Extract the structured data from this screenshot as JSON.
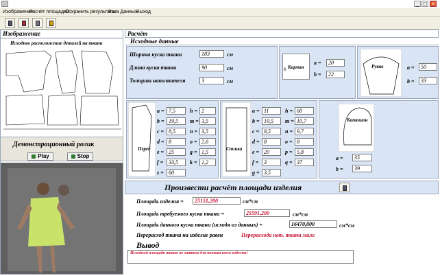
{
  "menu": [
    "Изображение",
    "Расчёт площадей",
    "Сохранить результаты",
    "База Данных",
    "Выход"
  ],
  "toolbar_icons": [
    "calculator-icon",
    "copy-icon",
    "print-icon",
    "exit-door-icon"
  ],
  "window_buttons": [
    "_",
    "□",
    "×"
  ],
  "left": {
    "header": "Изображение",
    "layout_title": "Исходное расположение деталей на ткани",
    "demo_title": "Демонстрационный ролик",
    "play": "Play",
    "stop": "Stop"
  },
  "right": {
    "header": "Расчёт",
    "source_header": "Исходные данные",
    "width_label": "Ширина куска ткани",
    "width_value": "183",
    "length_label": "Длина куска ткани",
    "length_value": "90",
    "filler_label": "Толщина наполнителя",
    "filler_value": "3",
    "unit": "см",
    "pocket": {
      "label": "Карман",
      "a": "20",
      "b": "22"
    },
    "sleeve": {
      "label": "Рукав",
      "a": "50",
      "b": "33"
    },
    "front": {
      "label": "Перед",
      "left": [
        {
          "k": "a",
          "v": "7,5"
        },
        {
          "k": "b",
          "v": "19,5"
        },
        {
          "k": "c",
          "v": "8,5"
        },
        {
          "k": "d",
          "v": "8"
        },
        {
          "k": "e",
          "v": "25"
        },
        {
          "k": "f",
          "v": "33,5"
        },
        {
          "k": "s",
          "v": "60"
        }
      ],
      "right": [
        {
          "k": "h",
          "v": "2"
        },
        {
          "k": "m",
          "v": "3,5"
        },
        {
          "k": "n",
          "v": "3,5"
        },
        {
          "k": "o",
          "v": "2,6"
        },
        {
          "k": "g",
          "v": "1,5"
        },
        {
          "k": "k",
          "v": "1,2"
        }
      ]
    },
    "back": {
      "label": "Спинка",
      "left": [
        {
          "k": "a",
          "v": "11"
        },
        {
          "k": "b",
          "v": "19,5"
        },
        {
          "k": "c",
          "v": "8,5"
        },
        {
          "k": "d",
          "v": "8"
        },
        {
          "k": "e",
          "v": "20"
        },
        {
          "k": "f",
          "v": "3"
        },
        {
          "k": "g",
          "v": "3,5"
        }
      ],
      "right": [
        {
          "k": "h",
          "v": "60"
        },
        {
          "k": "m",
          "v": "10,7"
        },
        {
          "k": "n",
          "v": "9,7"
        },
        {
          "k": "o",
          "v": "8"
        },
        {
          "k": "p",
          "v": "5,8"
        },
        {
          "k": "q",
          "v": "37"
        }
      ]
    },
    "hood": {
      "label": "Капюшон",
      "a": "35",
      "b": "39"
    },
    "compute_title": "Произвести расчёт площади изделия",
    "area_label": "Площадь изделия =",
    "area_value": "25151,200",
    "area_unit": "см*см",
    "required_label": "Площадь требуемого куска ткани =",
    "required_value": "25591,200",
    "given_label": "Площадь данного куска ткани (исходя из данных) =",
    "given_value": "16470,000",
    "overuse_label": "Перерасход ткани на изделие равен",
    "overuse_value": "Перерасхода нет. ткани мало",
    "conclusion_header": "Вывод",
    "conclusion_text": "Исходной площади ткани не хватит для пошива всего изделия!"
  }
}
